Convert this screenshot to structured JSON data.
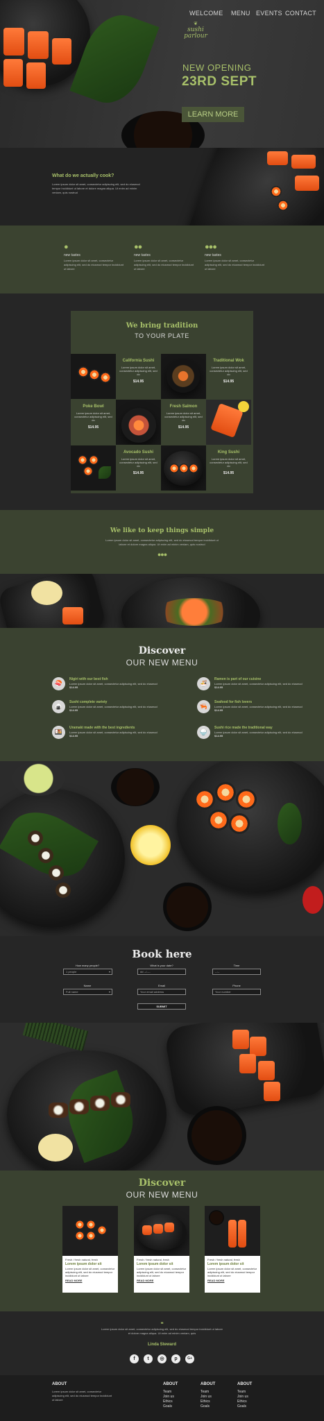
{
  "nav": {
    "welcome": "WELCOME",
    "menu": "MENU",
    "events": "EVENTS",
    "contact": "CONTACT"
  },
  "brand": {
    "line1": "sushi",
    "line2": "parlour"
  },
  "hero": {
    "subtitle": "NEW OPENING",
    "date": "23RD SEPT",
    "button": "LEARN MORE"
  },
  "about": {
    "heading": "What do we actually cook?",
    "body": "Lorem ipsum dolor sit amet, consectetur adipiscing elit, sed do eiusmod tempor incididunt ut labore et dolore magna aliqua. Ut enim ad minim veniam, quis nostrud"
  },
  "features": [
    {
      "title": "new tastes",
      "body": "Lorem ipsum dolor sit amet, consectetur adipiscing elit, sed do eiusmod tempor incididunt ut labore"
    },
    {
      "title": "new tastes",
      "body": "Lorem ipsum dolor sit amet, consectetur adipiscing elit, sed do eiusmod tempor incididunt ut labore"
    },
    {
      "title": "new tastes",
      "body": "Lorem ipsum dolor sit amet, consectetur adipiscing elit, sed do eiusmod tempor incididunt ut labore"
    }
  ],
  "tradition": {
    "title": "We bring tradition",
    "subtitle": "TO YOUR PLATE",
    "items": [
      {
        "name": "California Sushi",
        "desc": "Lorem ipsum dolor sit amet, consectetur adipiscing elit, sed do",
        "price": "$14.95"
      },
      {
        "name": "Traditional Wok",
        "desc": "Lorem ipsum dolor sit amet, consectetur adipiscing elit, sed do",
        "price": "$14.95"
      },
      {
        "name": "Poke Bowl",
        "desc": "Lorem ipsum dolor sit amet, consectetur adipiscing elit, sed do",
        "price": "$14.95"
      },
      {
        "name": "Fresh Salmon",
        "desc": "Lorem ipsum dolor sit amet, consectetur adipiscing elit, sed do",
        "price": "$14.95"
      },
      {
        "name": "Avocado Sushi",
        "desc": "Lorem ipsum dolor sit amet, consectetur adipiscing elit, sed do",
        "price": "$14.95"
      },
      {
        "name": "King Sushi",
        "desc": "Lorem ipsum dolor sit amet, consectetur adipiscing elit, sed do",
        "price": "$14.95"
      }
    ]
  },
  "simple": {
    "title": "We like to keep things simple",
    "body": "Lorem ipsum dolor sit amet, consectetur adipiscing elit, sed do eiusmod tempor incididunt ut labore et dolore magna aliqua. Ut enim ad minim veniam, quis nostrud"
  },
  "discover": {
    "title": "Discover",
    "subtitle": "OUR NEW MENU",
    "items": [
      {
        "title": "Nigiri with our best fish",
        "body": "Lorem ipsum dolor sit amet, consectetur adipiscing elit, sed do eiusmod",
        "price": "$14.95"
      },
      {
        "title": "Ramen is part of our cuisine",
        "body": "Lorem ipsum dolor sit amet, consectetur adipiscing elit, sed do eiusmod",
        "price": "$14.95"
      },
      {
        "title": "Sushi complete variety",
        "body": "Lorem ipsum dolor sit amet, consectetur adipiscing elit, sed do eiusmod",
        "price": "$14.95"
      },
      {
        "title": "Seafood for fish lovers",
        "body": "Lorem ipsum dolor sit amet, consectetur adipiscing elit, sed do eiusmod",
        "price": "$14.95"
      },
      {
        "title": "Uramaki made with the best ingredients",
        "body": "Lorem ipsum dolor sit amet, consectetur adipiscing elit, sed do eiusmod",
        "price": "$14.95"
      },
      {
        "title": "Sushi rice made the traditional way",
        "body": "Lorem ipsum dolor sit amet, consectetur adipiscing elit, sed do eiusmod",
        "price": "$14.95"
      }
    ]
  },
  "book": {
    "title": "Book here",
    "people_label": "How many people?",
    "people_value": "1 people",
    "date_label": "What is your date?",
    "date_value": "dd --/----",
    "time_label": "Time",
    "time_value": "--:--",
    "name_label": "Name",
    "name_value": "Full name",
    "email_label": "Email",
    "email_value": "Your email address",
    "phone_label": "Phone",
    "phone_value": "Your number",
    "submit": "SUBMIT"
  },
  "discover2": {
    "title": "Discover",
    "subtitle": "OUR NEW MENU",
    "cards": [
      {
        "caption": "Fresh / fresh natural, fresh",
        "title": "Lorem ipsum dolor sit",
        "body": "Lorem ipsum dolor sit amet, consectetur adipiscing elit, sed do eiusmod tempor incididunt ut labore",
        "more": "READ MORE"
      },
      {
        "caption": "Fresh / fresh natural, fresh",
        "title": "Lorem ipsum dolor sit",
        "body": "Lorem ipsum dolor sit amet, consectetur adipiscing elit, sed do eiusmod tempor incididunt ut labore",
        "more": "READ MORE"
      },
      {
        "caption": "Fresh / fresh natural, fresh",
        "title": "Lorem ipsum dolor sit",
        "body": "Lorem ipsum dolor sit amet, consectetur adipiscing elit, sed do eiusmod tempor incididunt ut labore",
        "more": "READ MORE"
      }
    ]
  },
  "testimonial": {
    "quote": "Lorem ipsum dolor sit amet, consectetur adipiscing elit, sed do eiusmod tempor incididunt ut labore et dolore magna aliqua. Ut enim ad minim veniam, quis",
    "author": "Linda Steward"
  },
  "social": [
    "f",
    "t",
    "◎",
    "p",
    "G+"
  ],
  "footer": {
    "about_title": "ABOUT",
    "about_body": "Lorem ipsum dolor sit amet, consectetur adipiscing elit, sed do eiusmod tempor incididunt ut labore",
    "col2_title": "ABOUT",
    "col2_links": [
      "Team",
      "Join us",
      "Ethics",
      "Goals"
    ],
    "col3_title": "ABOUT",
    "col3_links": [
      "Team",
      "Join us",
      "Ethics",
      "Goals"
    ],
    "col4_title": "ABOUT",
    "col4_links": [
      "Team",
      "Join us",
      "Ethics",
      "Goals"
    ]
  },
  "colors": {
    "accent": "#a8c16a",
    "olive": "#3a4230",
    "dark": "#262626"
  }
}
